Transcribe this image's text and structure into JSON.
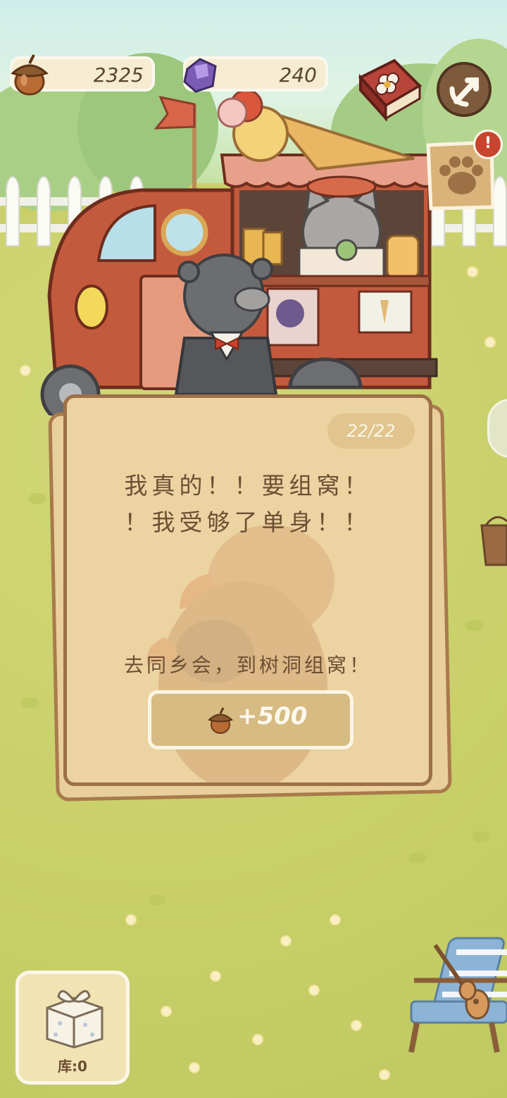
{
  "hud": {
    "acorns": {
      "icon": "acorn-icon",
      "value": "2325"
    },
    "gems": {
      "icon": "purple-gem-icon",
      "value": "240"
    },
    "book_button": {
      "icon": "flower-book-icon"
    },
    "back_button": {
      "icon": "return-arrow-icon"
    },
    "paw_notice": {
      "icon": "paw-print-icon",
      "alert": "!"
    }
  },
  "card": {
    "progress": "22/22",
    "message_line1": "我真的！！要组窝！",
    "message_line2": "！我受够了单身！！",
    "hint": "去同乡会，到树洞组窝！",
    "reward_icon": "acorn-icon",
    "reward": "+500"
  },
  "storage": {
    "icon": "gift-box-icon",
    "label": "库:0"
  },
  "colors": {
    "grass": "#c9d06a",
    "card": "#ecd3a2",
    "card_border": "#9d7048",
    "text": "#6d4f34",
    "truck_red": "#c45a3d"
  }
}
